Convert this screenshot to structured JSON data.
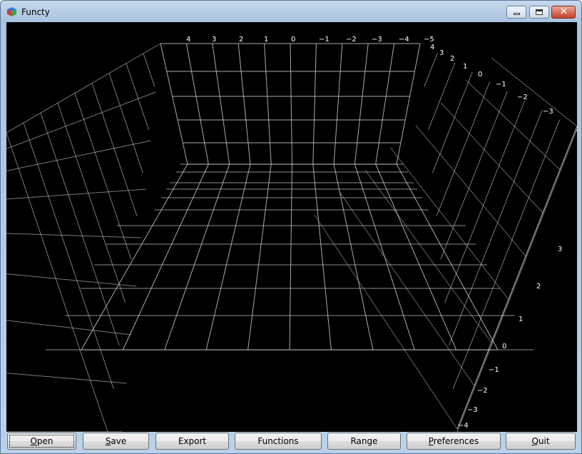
{
  "window": {
    "title": "Functy",
    "controls": [
      "minimize",
      "maximize",
      "close"
    ]
  },
  "plot": {
    "background": "#000000",
    "grid_color": "#c8c8c8",
    "x_axis_ticks": [
      "4",
      "3",
      "2",
      "1",
      "0",
      "−1",
      "−2",
      "−3",
      "−4",
      "−5"
    ],
    "y_axis_ticks": [
      "4",
      "3",
      "2",
      "1",
      "0",
      "−1",
      "−2",
      "−3",
      "−"
    ],
    "z_axis_ticks": [
      "3",
      "2",
      "1",
      "0",
      "−1",
      "−2",
      "−3",
      "−4"
    ]
  },
  "buttons": [
    {
      "label": "Open",
      "mnemonic": "O",
      "rest": "pen"
    },
    {
      "label": "Save",
      "mnemonic": "S",
      "rest": "ave"
    },
    {
      "label": "Export",
      "mnemonic": "",
      "rest": "Export"
    },
    {
      "label": "Functions",
      "mnemonic": "",
      "rest": "Functions"
    },
    {
      "label": "Range",
      "mnemonic": "",
      "rest": "Range"
    },
    {
      "label": "Preferences",
      "mnemonic": "P",
      "rest": "references"
    },
    {
      "label": "Quit",
      "mnemonic": "Q",
      "rest": "uit"
    }
  ]
}
